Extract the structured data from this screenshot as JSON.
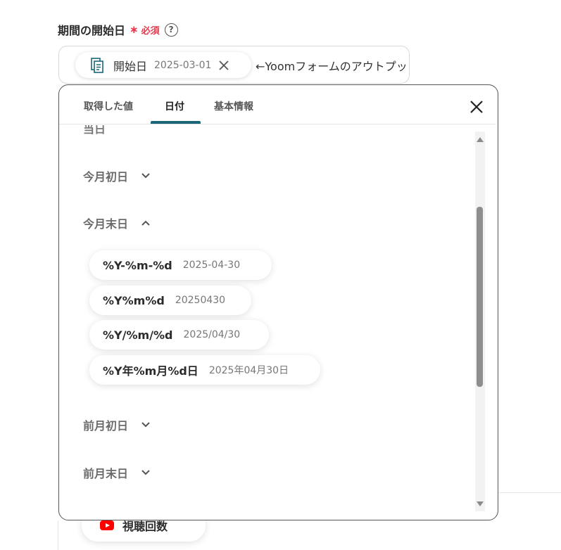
{
  "field": {
    "label": "期間の開始日",
    "required_star": "∗",
    "required_text": "必須",
    "help_icon": "?"
  },
  "input": {
    "chip_icon": "form-icon",
    "chip_label": "開始日",
    "chip_value": "2025-03-01",
    "after_text": "←Yoomフォームのアウトプッ"
  },
  "panel": {
    "tabs": [
      {
        "label": "取得した値",
        "active": false
      },
      {
        "label": "日付",
        "active": true
      },
      {
        "label": "基本情報",
        "active": false
      }
    ],
    "accent_color": "#1b6777",
    "partial_section": "当日",
    "sections": {
      "first_of_month": "今月初日",
      "end_of_month": "今月末日",
      "prev_first": "前月初日",
      "prev_end": "前月末日"
    },
    "options": [
      {
        "format": "%Y-%m-%d",
        "example": "2025-04-30"
      },
      {
        "format": "%Y%m%d",
        "example": "20250430"
      },
      {
        "format": "%Y/%m/%d",
        "example": "2025/04/30"
      },
      {
        "format": "%Y年%m月%d日",
        "example": "2025年04月30日"
      }
    ]
  },
  "background": {
    "chip_icon": "youtube-icon",
    "chip_label": "視聴回数"
  },
  "colors": {
    "required": "#e8384f"
  }
}
